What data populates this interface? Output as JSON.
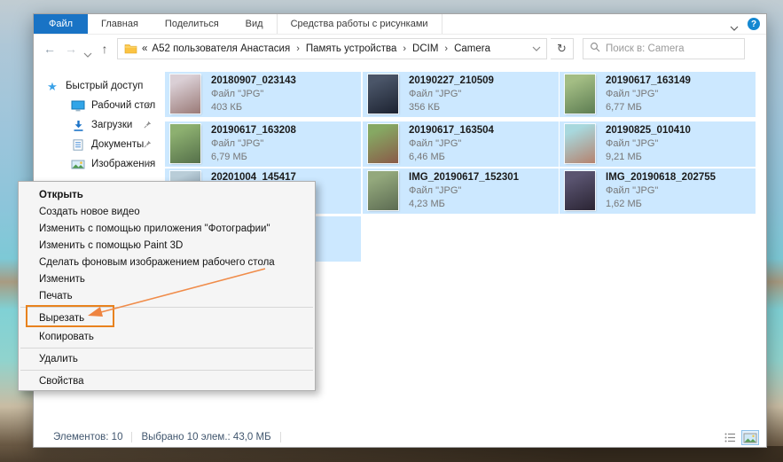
{
  "tabs": {
    "file": "Файл",
    "home": "Главная",
    "share": "Поделиться",
    "view": "Вид",
    "contextual": "Средства работы с рисунками",
    "help_glyph": "?"
  },
  "address": {
    "prefix": "«",
    "separator": "›",
    "crumbs": [
      "A52 пользователя Анастасия",
      "Память устройства",
      "DCIM",
      "Camera"
    ]
  },
  "search": {
    "placeholder": "Поиск в: Camera"
  },
  "sidebar": {
    "items": [
      {
        "label": "Быстрый доступ"
      },
      {
        "label": "Рабочий стол"
      },
      {
        "label": "Загрузки"
      },
      {
        "label": "Документы"
      },
      {
        "label": "Изображения"
      }
    ]
  },
  "files": [
    {
      "name": "20180907_023143",
      "type": "Файл \"JPG\"",
      "size": "403 КБ",
      "thumb": [
        "#dacfd5",
        "#9a7a77"
      ]
    },
    {
      "name": "20190227_210509",
      "type": "Файл \"JPG\"",
      "size": "356 КБ",
      "thumb": [
        "#4a5568",
        "#1c2230"
      ]
    },
    {
      "name": "20190617_163149",
      "type": "Файл \"JPG\"",
      "size": "6,77 МБ",
      "thumb": [
        "#a3bd84",
        "#5d7d52"
      ]
    },
    {
      "name": "20190617_163208",
      "type": "Файл \"JPG\"",
      "size": "6,79 МБ",
      "thumb": [
        "#8db070",
        "#55704a"
      ]
    },
    {
      "name": "20190617_163504",
      "type": "Файл \"JPG\"",
      "size": "6,46 МБ",
      "thumb": [
        "#86a863",
        "#8a5a48"
      ]
    },
    {
      "name": "20190825_010410",
      "type": "Файл \"JPG\"",
      "size": "9,21 МБ",
      "thumb": [
        "#a8d8dd",
        "#b5826e"
      ]
    },
    {
      "name": "20201004_145417",
      "type": "",
      "size": "",
      "thumb": [
        "#b9cdd8",
        "#5d7184"
      ]
    },
    {
      "name": "IMG_20190617_152301",
      "type": "Файл \"JPG\"",
      "size": "4,23 МБ",
      "thumb": [
        "#93a87c",
        "#5c6b52"
      ]
    },
    {
      "name": "IMG_20190618_202755",
      "type": "Файл \"JPG\"",
      "size": "1,62 МБ",
      "thumb": [
        "#5a5470",
        "#2a2433"
      ]
    },
    {
      "name": "",
      "type": "",
      "size": ""
    }
  ],
  "context_menu": {
    "items": [
      "Открыть",
      "Создать новое видео",
      "Изменить с помощью приложения \"Фотографии\"",
      "Изменить с помощью Paint 3D",
      "Сделать фоновым изображением рабочего стола",
      "Изменить",
      "Печать",
      "Вырезать",
      "Копировать",
      "Удалить",
      "Свойства"
    ]
  },
  "status": {
    "count": "Элементов: 10",
    "selection": "Выбрано 10 элем.: 43,0 МБ"
  },
  "colors": {
    "accent_blue": "#1973c5",
    "selection_blue": "#cce8ff",
    "annotation_orange": "#e8821e"
  }
}
